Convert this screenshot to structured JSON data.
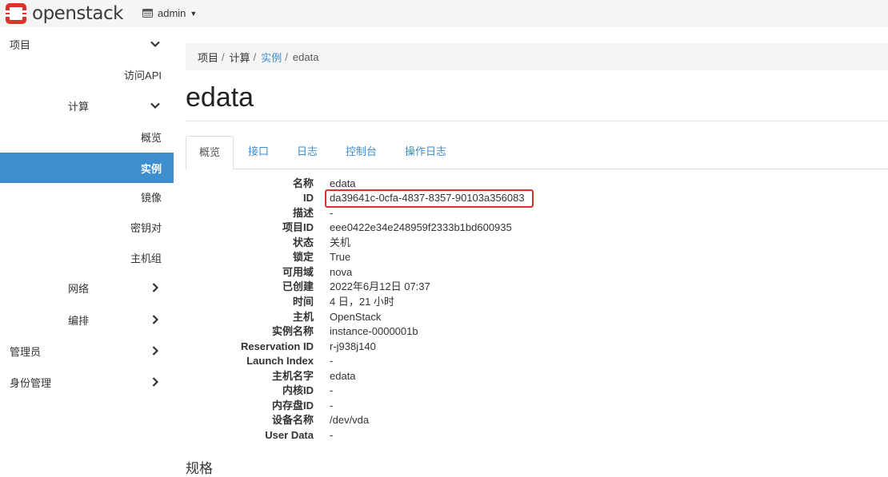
{
  "topbar": {
    "brand": "openstack",
    "project": "admin"
  },
  "sidebar": {
    "items": [
      {
        "label": "项目",
        "chevron": "down"
      },
      {
        "label": "访问API"
      },
      {
        "label": "计算",
        "chevron": "down"
      },
      {
        "label": "概览"
      },
      {
        "label": "实例",
        "active": true
      },
      {
        "label": "镜像"
      },
      {
        "label": "密钥对"
      },
      {
        "label": "主机组"
      },
      {
        "label": "网络",
        "chevron": "right"
      },
      {
        "label": "编排",
        "chevron": "right"
      },
      {
        "label": "管理员",
        "chevron": "right"
      },
      {
        "label": "身份管理",
        "chevron": "right"
      }
    ]
  },
  "breadcrumb": {
    "items": [
      "项目",
      "计算",
      "实例",
      "edata"
    ]
  },
  "page": {
    "title": "edata",
    "section_title": "规格"
  },
  "tabs": [
    "概览",
    "接口",
    "日志",
    "控制台",
    "操作日志"
  ],
  "details": [
    {
      "label": "名称",
      "value": "edata"
    },
    {
      "label": "ID",
      "value": "da39641c-0cfa-4837-8357-90103a356083"
    },
    {
      "label": "描述",
      "value": "-"
    },
    {
      "label": "项目ID",
      "value": "eee0422e34e248959f2333b1bd600935"
    },
    {
      "label": "状态",
      "value": "关机"
    },
    {
      "label": "锁定",
      "value": "True"
    },
    {
      "label": "可用域",
      "value": "nova"
    },
    {
      "label": "已创建",
      "value": "2022年6月12日 07:37"
    },
    {
      "label": "时间",
      "value": "4 日，21 小时"
    },
    {
      "label": "主机",
      "value": "OpenStack"
    },
    {
      "label": "实例名称",
      "value": "instance-0000001b"
    },
    {
      "label": "Reservation ID",
      "value": "r-j938j140"
    },
    {
      "label": "Launch Index",
      "value": "-"
    },
    {
      "label": "主机名字",
      "value": "edata"
    },
    {
      "label": "内核ID",
      "value": "-"
    },
    {
      "label": "内存盘ID",
      "value": "-"
    },
    {
      "label": "设备名称",
      "value": "/dev/vda"
    },
    {
      "label": "User Data",
      "value": "-"
    }
  ],
  "colors": {
    "accent": "#3e8dcf",
    "logo_red": "#d9342b",
    "highlight": "#d9342b"
  }
}
